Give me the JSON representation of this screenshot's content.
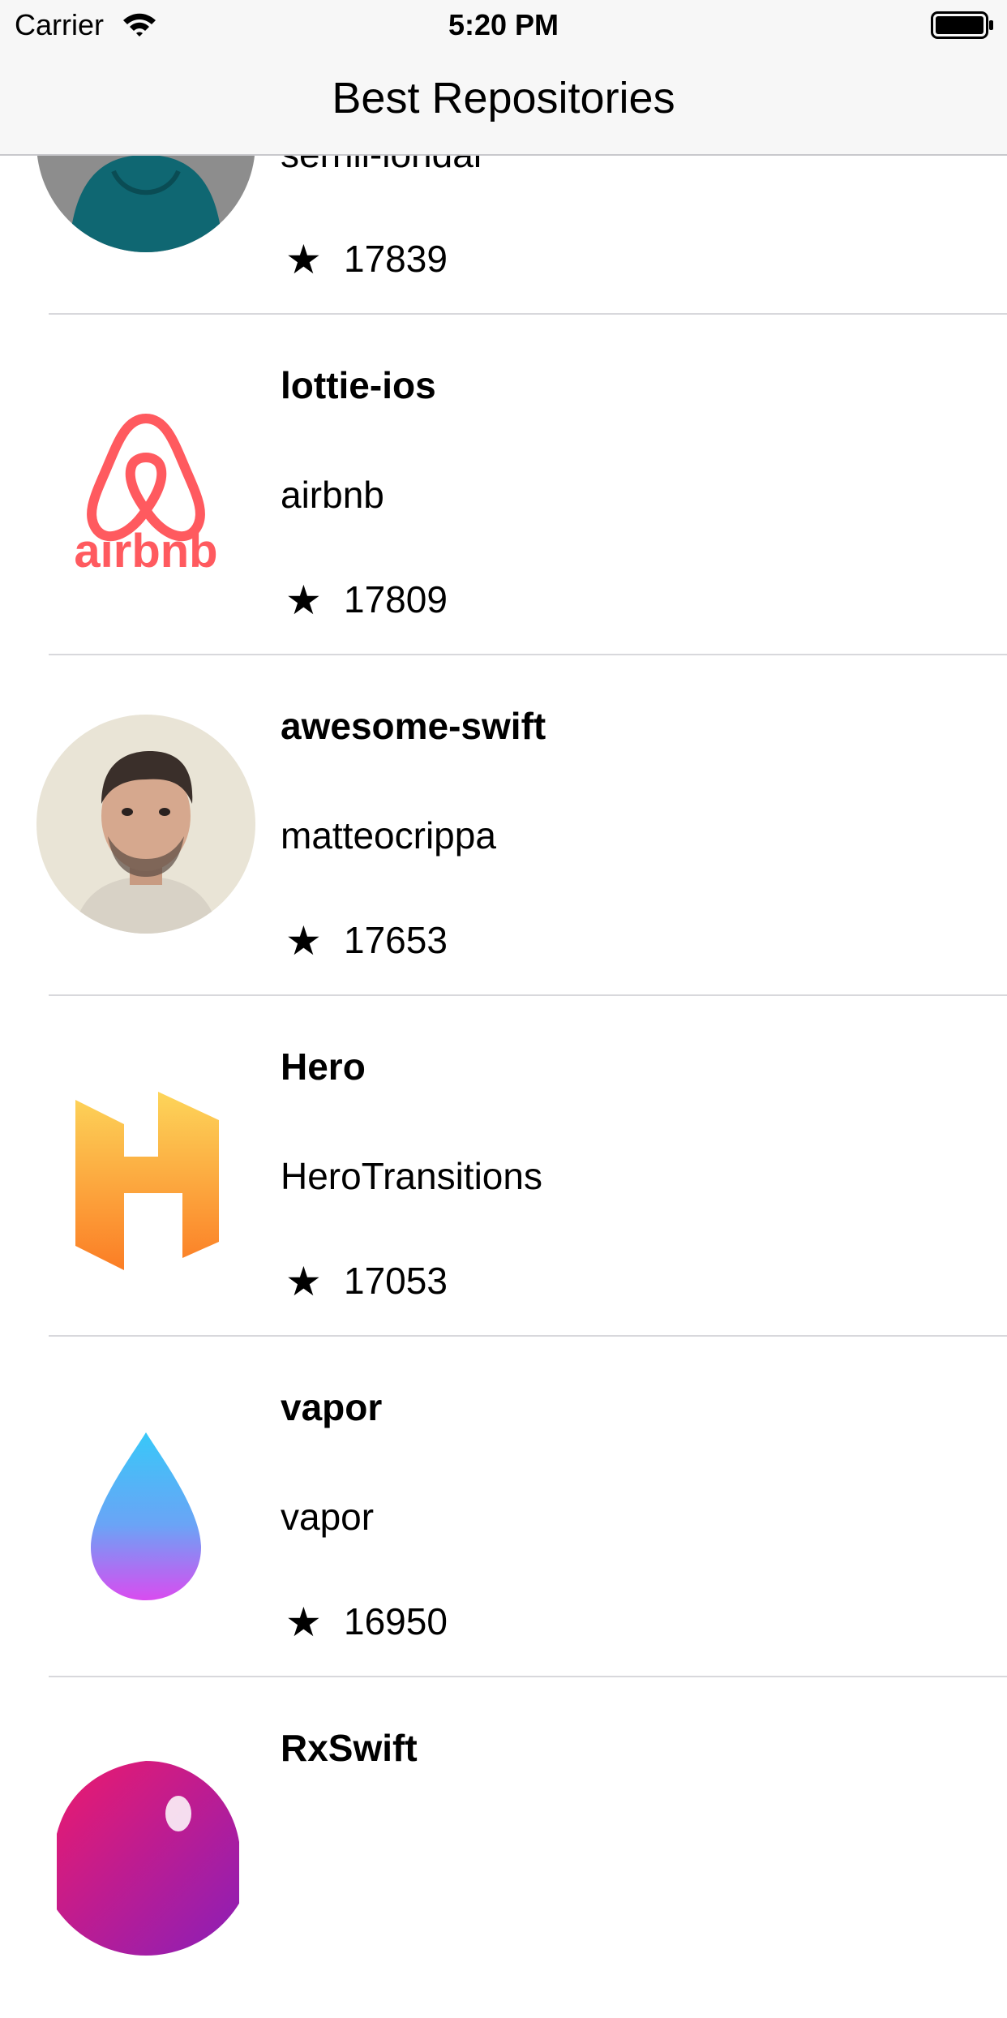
{
  "status_bar": {
    "carrier": "Carrier",
    "time": "5:20 PM"
  },
  "nav": {
    "title": "Best Repositories"
  },
  "repos": [
    {
      "name": "",
      "owner": "sernii-iondar",
      "stars": "17839",
      "avatar_icon": "person-teal-hoodie-avatar"
    },
    {
      "name": "lottie-ios",
      "owner": "airbnb",
      "stars": "17809",
      "avatar_icon": "airbnb-logo",
      "accent": "#ff5a5f"
    },
    {
      "name": "awesome-swift",
      "owner": "matteocrippa",
      "stars": "17653",
      "avatar_icon": "person-photo-avatar"
    },
    {
      "name": "Hero",
      "owner": "HeroTransitions",
      "stars": "17053",
      "avatar_icon": "hero-h-logo",
      "accent": "#fda43a"
    },
    {
      "name": "vapor",
      "owner": "vapor",
      "stars": "16950",
      "avatar_icon": "vapor-drop-logo",
      "accent": "#4cc3fb"
    },
    {
      "name": "RxSwift",
      "owner": "",
      "stars": "",
      "avatar_icon": "rxswift-logo",
      "accent": "#d81b7a"
    }
  ]
}
